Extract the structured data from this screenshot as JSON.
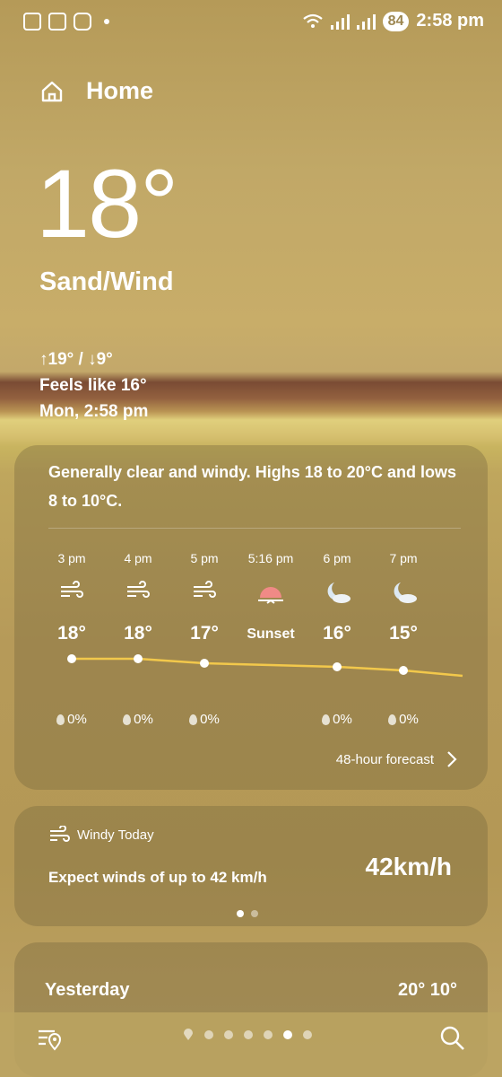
{
  "status_bar": {
    "time": "2:58 pm",
    "battery": "84",
    "left_icons": [
      "screenshot-icon",
      "gallery-icon",
      "instagram-icon"
    ]
  },
  "header": {
    "title": "Home"
  },
  "current": {
    "temperature": "18°",
    "condition": "Sand/Wind",
    "high_low": "↑19° / ↓9°",
    "feels_like": "Feels like 16°",
    "datetime": "Mon, 2:58 pm"
  },
  "forecast_card": {
    "summary": "Generally clear and windy. Highs 18 to 20°C and lows 8 to 10°C.",
    "hours": [
      {
        "time": "3 pm",
        "icon": "wind-icon",
        "temp": "18°",
        "precip": "0%"
      },
      {
        "time": "4 pm",
        "icon": "wind-icon",
        "temp": "18°",
        "precip": "0%"
      },
      {
        "time": "5 pm",
        "icon": "wind-icon",
        "temp": "17°",
        "precip": "0%"
      },
      {
        "time": "5:16 pm",
        "icon": "sunset-icon",
        "temp": "Sunset",
        "precip": ""
      },
      {
        "time": "6 pm",
        "icon": "moon-cloud-icon",
        "temp": "16°",
        "precip": "0%"
      },
      {
        "time": "7 pm",
        "icon": "moon-cloud-icon",
        "temp": "15°",
        "precip": "0%"
      }
    ],
    "link_label": "48-hour forecast"
  },
  "wind_card": {
    "title": "Windy Today",
    "text": "Expect winds of up to 42 km/h",
    "speed": "42km/h"
  },
  "yesterday": {
    "label": "Yesterday",
    "temps": "20° 10°"
  },
  "colors": {
    "accent_line": "#f2c84b",
    "sunset": "#f08a86"
  }
}
